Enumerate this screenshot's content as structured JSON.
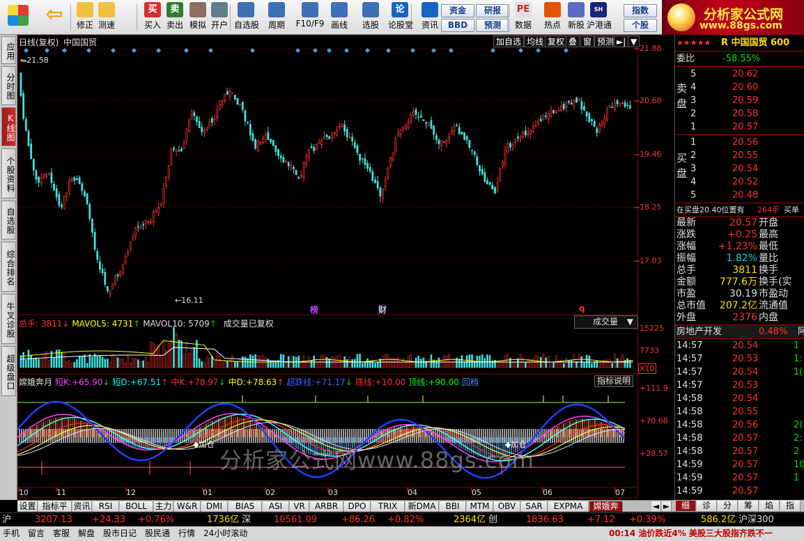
{
  "toolbar": {
    "buttons": [
      {
        "label": "修正",
        "icon": "up-down-arrows-icon"
      },
      {
        "label": "测速",
        "icon": "stopwatch-icon"
      },
      {
        "label": "买入",
        "icon": "buy-icon",
        "glyph": "买"
      },
      {
        "label": "卖出",
        "icon": "sell-icon",
        "glyph": "卖"
      },
      {
        "label": "模拟",
        "icon": "hammer-icon"
      },
      {
        "label": "开户",
        "icon": "lock-icon"
      },
      {
        "label": "自选股",
        "icon": "star-folder-icon"
      },
      {
        "label": "周期",
        "icon": "clock-icon"
      },
      {
        "label": "F10/F9",
        "icon": "chart-window-icon"
      },
      {
        "label": "画线",
        "icon": "pencil-icon"
      },
      {
        "label": "选股",
        "icon": "screen-icon"
      },
      {
        "label": "论股堂",
        "icon": "discuss-icon",
        "glyph": "论"
      },
      {
        "label": "资讯",
        "icon": "news-icon"
      },
      {
        "label": "数据",
        "icon": "pe-icon",
        "glyph": "PE"
      },
      {
        "label": "热点",
        "icon": "hot-icon"
      },
      {
        "label": "新股",
        "icon": "new-stock-icon"
      },
      {
        "label": "沪港通",
        "icon": "shhk-icon",
        "glyph": "SH HK"
      }
    ],
    "pills": [
      "资金",
      "研报",
      "BBD",
      "预测",
      "指数",
      "个股"
    ]
  },
  "logo": {
    "title": "分析家公式网",
    "url": "www.88gs.com"
  },
  "left_tabs": [
    "应用",
    "分时图",
    "K线图",
    "个股资料",
    "自选股",
    "综合排名",
    "牛叉诊股",
    "超级盘口"
  ],
  "left_active": "K线图",
  "chart": {
    "header": {
      "period": "日线(复权)",
      "name": "中国国贸"
    },
    "top_buttons": [
      "加自选",
      "均线",
      "复权",
      "叠",
      "窗",
      "预测"
    ],
    "price_axis": [
      "21.88",
      "20.68",
      "19.46",
      "18.25",
      "17.03"
    ],
    "high_marker": "21.58",
    "low_marker": "16.11",
    "event_marks": [
      "榜",
      "财",
      "q"
    ],
    "volume_header": {
      "total_label": "总手:",
      "total": "3811",
      "ma5_label": "MAVOL5:",
      "ma5": "4731",
      "ma10_label": "MAVOL10:",
      "ma10": "5709",
      "note": "成交量已复权",
      "dropdown": "成交量"
    },
    "volume_axis": [
      "15225",
      "7733"
    ],
    "volume_scale": "X10",
    "indicator_header": {
      "name": "嫦娥奔月",
      "items": [
        {
          "label": "短K:",
          "value": "+65.90",
          "color": "#ff40ff"
        },
        {
          "label": "短D:",
          "value": "+67.51",
          "color": "#00ffff"
        },
        {
          "label": "中K:",
          "value": "+78.97",
          "color": "#ff3030"
        },
        {
          "label": "中D:",
          "value": "+78.63",
          "color": "#ffff00"
        },
        {
          "label": "超跌线:",
          "value": "+71.17",
          "color": "#4060ff"
        },
        {
          "label": "底线:",
          "value": "+10.00",
          "color": "#ff3030"
        },
        {
          "label": "顶线:",
          "value": "+90.00",
          "color": "#00ff00"
        }
      ],
      "extra": "回档",
      "help": "指标说明"
    },
    "indicator_axis": [
      "+111.9",
      "+70.68",
      "+28.57"
    ],
    "annotations": [
      "加仓",
      "加仓"
    ],
    "watermark": "分析家公式网www.88gs.com",
    "months": [
      "10",
      "11",
      "12",
      "01",
      "02",
      "03",
      "04",
      "05",
      "06",
      "07"
    ],
    "colors": {
      "up": "#ff3030",
      "down": "#40e0e0",
      "grid": "#8b0000"
    }
  },
  "quote": {
    "stars": "★★★★★",
    "title": "R 中国国贸 600",
    "weibi_label": "委比",
    "weibi": "-58.55%",
    "sell_label": "卖盘",
    "buy_label": "买盘",
    "asks": [
      {
        "lvl": "5",
        "price": "20.62"
      },
      {
        "lvl": "4",
        "price": "20.60"
      },
      {
        "lvl": "3",
        "price": "20.59"
      },
      {
        "lvl": "2",
        "price": "20.58"
      },
      {
        "lvl": "1",
        "price": "20.57"
      }
    ],
    "bids": [
      {
        "lvl": "1",
        "price": "20.56"
      },
      {
        "lvl": "2",
        "price": "20.55"
      },
      {
        "lvl": "3",
        "price": "20.54"
      },
      {
        "lvl": "4",
        "price": "20.52"
      },
      {
        "lvl": "5",
        "price": "20.48"
      }
    ],
    "buy_note": "在买盘20.40位置有",
    "buy_note_qty": "264手",
    "buy_note_tail": "买单",
    "stats": [
      {
        "k": "最新",
        "v": "20.57",
        "k2": "开盘",
        "c": "q-red"
      },
      {
        "k": "涨跌",
        "v": "+0.25",
        "k2": "最高",
        "c": "q-red"
      },
      {
        "k": "涨幅",
        "v": "+1.23%",
        "k2": "最低",
        "c": "q-red"
      },
      {
        "k": "振幅",
        "v": "1.82%",
        "k2": "量比",
        "c": "q-cyan"
      },
      {
        "k": "总手",
        "v": "3811",
        "k2": "换手",
        "c": "q-yellow"
      },
      {
        "k": "金额",
        "v": "777.6万",
        "k2": "换手(实",
        "c": "q-yellow"
      },
      {
        "k": "市盈",
        "v": "30.19",
        "k2": "市盈动",
        "c": "q-white"
      },
      {
        "k": "总市值",
        "v": "207.2亿",
        "k2": "流通值",
        "c": "q-yellow"
      },
      {
        "k": "外盘",
        "v": "2376",
        "k2": "内盘",
        "c": "q-red"
      }
    ],
    "sector": {
      "name": "房地产开发",
      "change": "0.48%",
      "tail": "阿"
    },
    "ticks": [
      {
        "t": "14:57",
        "p": "20.54",
        "c": "q-red",
        "v": "1"
      },
      {
        "t": "14:57",
        "p": "20.53",
        "c": "q-red",
        "v": "1:"
      },
      {
        "t": "14:57",
        "p": "20.54",
        "c": "q-red",
        "v": "1("
      },
      {
        "t": "14:57",
        "p": "20.53",
        "c": "q-red",
        "v": ""
      },
      {
        "t": "14:58",
        "p": "20.54",
        "c": "q-red",
        "v": ""
      },
      {
        "t": "14:58",
        "p": "20.55",
        "c": "q-red",
        "v": ""
      },
      {
        "t": "14:58",
        "p": "20.56",
        "c": "q-red",
        "v": "2("
      },
      {
        "t": "14:58",
        "p": "20.57",
        "c": "q-red",
        "v": "2:"
      },
      {
        "t": "14:58",
        "p": "20.57",
        "c": "q-red",
        "v": "2"
      },
      {
        "t": "14:59",
        "p": "20.57",
        "c": "q-red",
        "v": "10"
      },
      {
        "t": "14:59",
        "p": "20.57",
        "c": "q-red",
        "v": "1"
      },
      {
        "t": "14:59",
        "p": "20.57",
        "c": "q-red",
        "v": ""
      }
    ]
  },
  "bottom_tabs": [
    "设置",
    "指标平台",
    "资讯",
    "RSI",
    "BOLL",
    "主力",
    "W&R",
    "DMI",
    "BIAS",
    "ASI",
    "VR",
    "ARBR",
    "DPO",
    "TRIX",
    "新DMA",
    "BBI",
    "MTM",
    "OBV",
    "SAR",
    "EXPMA",
    "嫦娥奔月"
  ],
  "bottom_active": "嫦娥奔月",
  "right_tabs": [
    "细",
    "诊",
    "分",
    "筹",
    "焰",
    "指"
  ],
  "status1": {
    "sh_label": "沪",
    "sh": "3207.13",
    "sh_chg": "+24.33",
    "sh_pct": "+0.76%",
    "sh_amt": "1736亿",
    "sz_label": "深",
    "sz": "10561.09",
    "sz_chg": "+86.26",
    "sz_pct": "+0.82%",
    "sz_amt": "2364亿",
    "cy_label": "创",
    "cy": "1836.63",
    "cy_chg": "+7.12",
    "cy_pct": "+0.39%",
    "cy_amt": "586.2亿",
    "hs_label": "沪深300"
  },
  "status2": {
    "items": [
      "手机",
      "留言",
      "客服",
      "解盘",
      "股市日记",
      "股民通",
      "行情",
      "24小时滚动"
    ],
    "ticker": "00:14 油价跌近4% 美股三大股指齐跌不一"
  }
}
